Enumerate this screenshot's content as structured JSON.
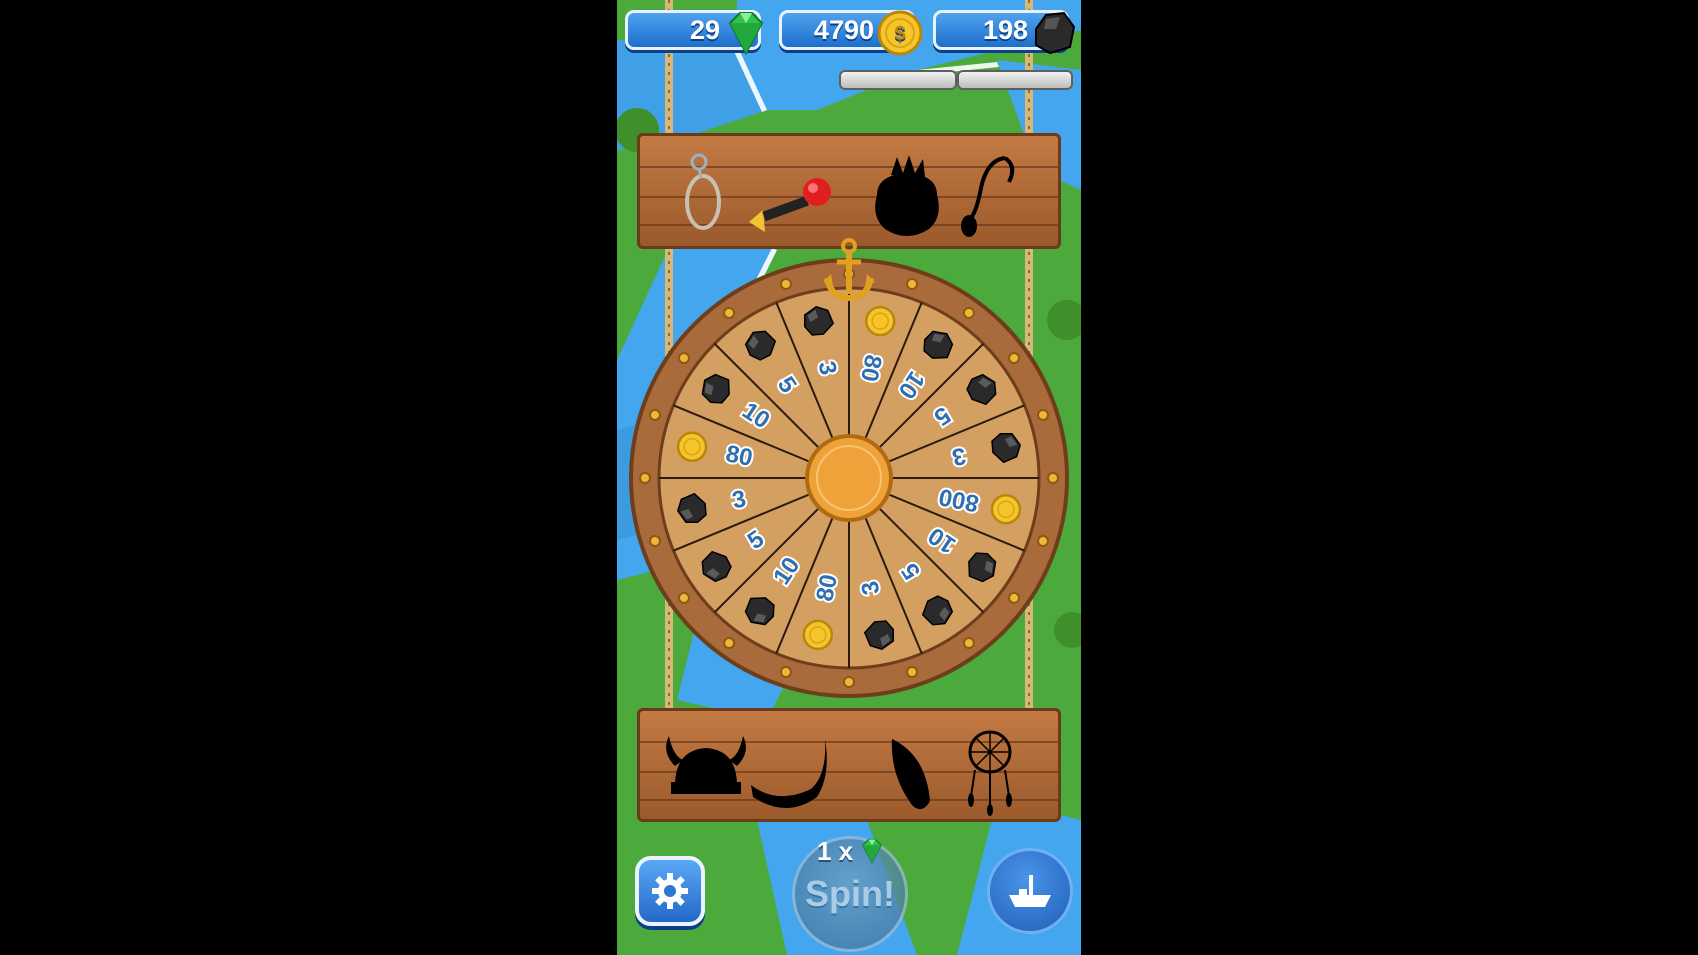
{
  "currencies": {
    "gems": "29",
    "coins": "4790",
    "coal": "198"
  },
  "icons": {
    "gem": "green-gem-icon",
    "coin": "gold-coin-icon",
    "coal": "coal-lump-icon",
    "anchor": "anchor-icon",
    "settings": "gear-icon",
    "boat": "boat-icon"
  },
  "collection_top": [
    "lasso-rope",
    "horn-trumpet",
    "tribal-mask",
    "hook-pendant"
  ],
  "collection_bottom": [
    "viking-helmet",
    "drinking-horn",
    "leaf-blade",
    "dreamcatcher"
  ],
  "wheel": {
    "segments": [
      {
        "label": "80",
        "reward": "coin"
      },
      {
        "label": "10",
        "reward": "coal"
      },
      {
        "label": "5",
        "reward": "coal"
      },
      {
        "label": "3",
        "reward": "coal"
      },
      {
        "label": "800",
        "reward": "coin"
      },
      {
        "label": "10",
        "reward": "coal"
      },
      {
        "label": "5",
        "reward": "coal"
      },
      {
        "label": "3",
        "reward": "coal"
      },
      {
        "label": "80",
        "reward": "coin"
      },
      {
        "label": "10",
        "reward": "coal"
      },
      {
        "label": "5",
        "reward": "coal"
      },
      {
        "label": "3",
        "reward": "coal"
      },
      {
        "label": "80",
        "reward": "coin"
      },
      {
        "label": "10",
        "reward": "coal"
      },
      {
        "label": "5",
        "reward": "coal"
      },
      {
        "label": "3",
        "reward": "coal"
      }
    ]
  },
  "spin": {
    "cost_label": "1 x",
    "button_label": "Spin!"
  },
  "colors": {
    "wheel_wood": "#a96a3c",
    "wheel_face": "#d4a062",
    "number_blue": "#2e6fb3",
    "hub": "#f0a23a",
    "plank": "#b06a36",
    "button_blue": "#2a78d4"
  }
}
